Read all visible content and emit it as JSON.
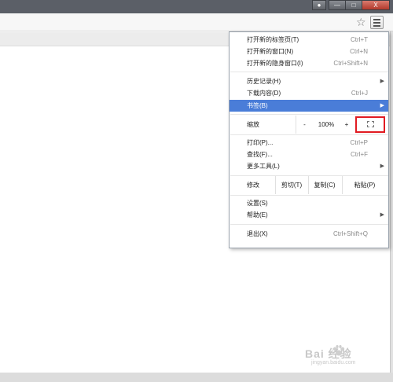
{
  "menu": {
    "items": [
      {
        "label": "打开新的标签页(T)",
        "shortcut": "Ctrl+T"
      },
      {
        "label": "打开新的窗口(N)",
        "shortcut": "Ctrl+N"
      },
      {
        "label": "打开新的隐身窗口(I)",
        "shortcut": "Ctrl+Shift+N"
      },
      {
        "label": "历史记录(H)"
      },
      {
        "label": "下载内容(D)",
        "shortcut": "Ctrl+J"
      },
      {
        "label": "书签(B)"
      },
      {
        "label": "打印(P)...",
        "shortcut": "Ctrl+P"
      },
      {
        "label": "查找(F)...",
        "shortcut": "Ctrl+F"
      },
      {
        "label": "更多工具(L)"
      },
      {
        "label": "设置(S)"
      },
      {
        "label": "帮助(E)"
      },
      {
        "label": "退出(X)",
        "shortcut": "Ctrl+Shift+Q"
      }
    ],
    "zoom": {
      "label": "缩放",
      "minus": "-",
      "value": "100%",
      "plus": "+"
    },
    "edit": {
      "label": "修改",
      "cut": "剪切(T)",
      "copy": "复制(C)",
      "paste": "粘贴(P)"
    }
  },
  "toolbar": {
    "star_icon": "☆"
  },
  "window_controls": {
    "minimize": "—",
    "maximize": "□",
    "close": "X"
  },
  "colors": {
    "highlight": "#4a7dd8",
    "fullscreen_outline": "#e11b22"
  },
  "watermark": {
    "main": "Bai 经验",
    "sub": "jingyan.baidu.com"
  }
}
